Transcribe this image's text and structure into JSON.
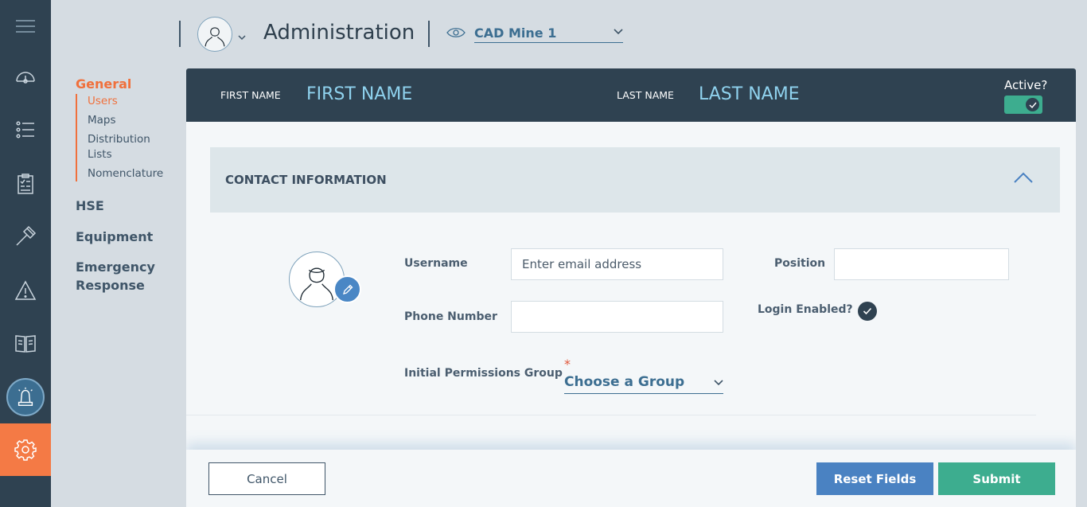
{
  "header": {
    "title": "Administration",
    "site_select": "CAD Mine 1"
  },
  "nav": {
    "sections": {
      "general": "General",
      "hse": "HSE",
      "equipment": "Equipment",
      "emergency": "Emergency Response"
    },
    "general_items": [
      "Users",
      "Maps",
      "Distribution Lists",
      "Nomenclature"
    ],
    "active_item": "Users"
  },
  "rail": {
    "icons": [
      "hamburger-menu-icon",
      "dashboard-gauge-icon",
      "list-icon",
      "clipboard-checklist-icon",
      "hammer-icon",
      "warning-triangle-icon",
      "book-icon",
      "alarm-beacon-icon",
      "gear-icon"
    ],
    "active": "gear-icon"
  },
  "user_header": {
    "first_name_label": "FIRST NAME",
    "first_name_value": "FIRST NAME",
    "last_name_label": "LAST NAME",
    "last_name_value": "LAST NAME",
    "active_label": "Active?",
    "active": true
  },
  "contact": {
    "section_title": "CONTACT INFORMATION",
    "username_label": "Username",
    "username_placeholder": "Enter email address",
    "position_label": "Position",
    "phone_label": "Phone Number",
    "login_enabled_label": "Login Enabled?",
    "login_enabled": true,
    "permissions_label": "Initial Permissions Group",
    "required_marker": "*",
    "permissions_select": "Choose a Group"
  },
  "footer": {
    "cancel_label": "Cancel",
    "reset_label": "Reset Fields",
    "submit_label": "Submit"
  },
  "colors": {
    "rail_bg": "#2f4251",
    "accent_orange": "#f47a45",
    "header_value": "#8fd2ee",
    "link_blue": "#3c6e91",
    "reset_blue": "#4a82c2",
    "submit_green": "#3dad8f"
  }
}
